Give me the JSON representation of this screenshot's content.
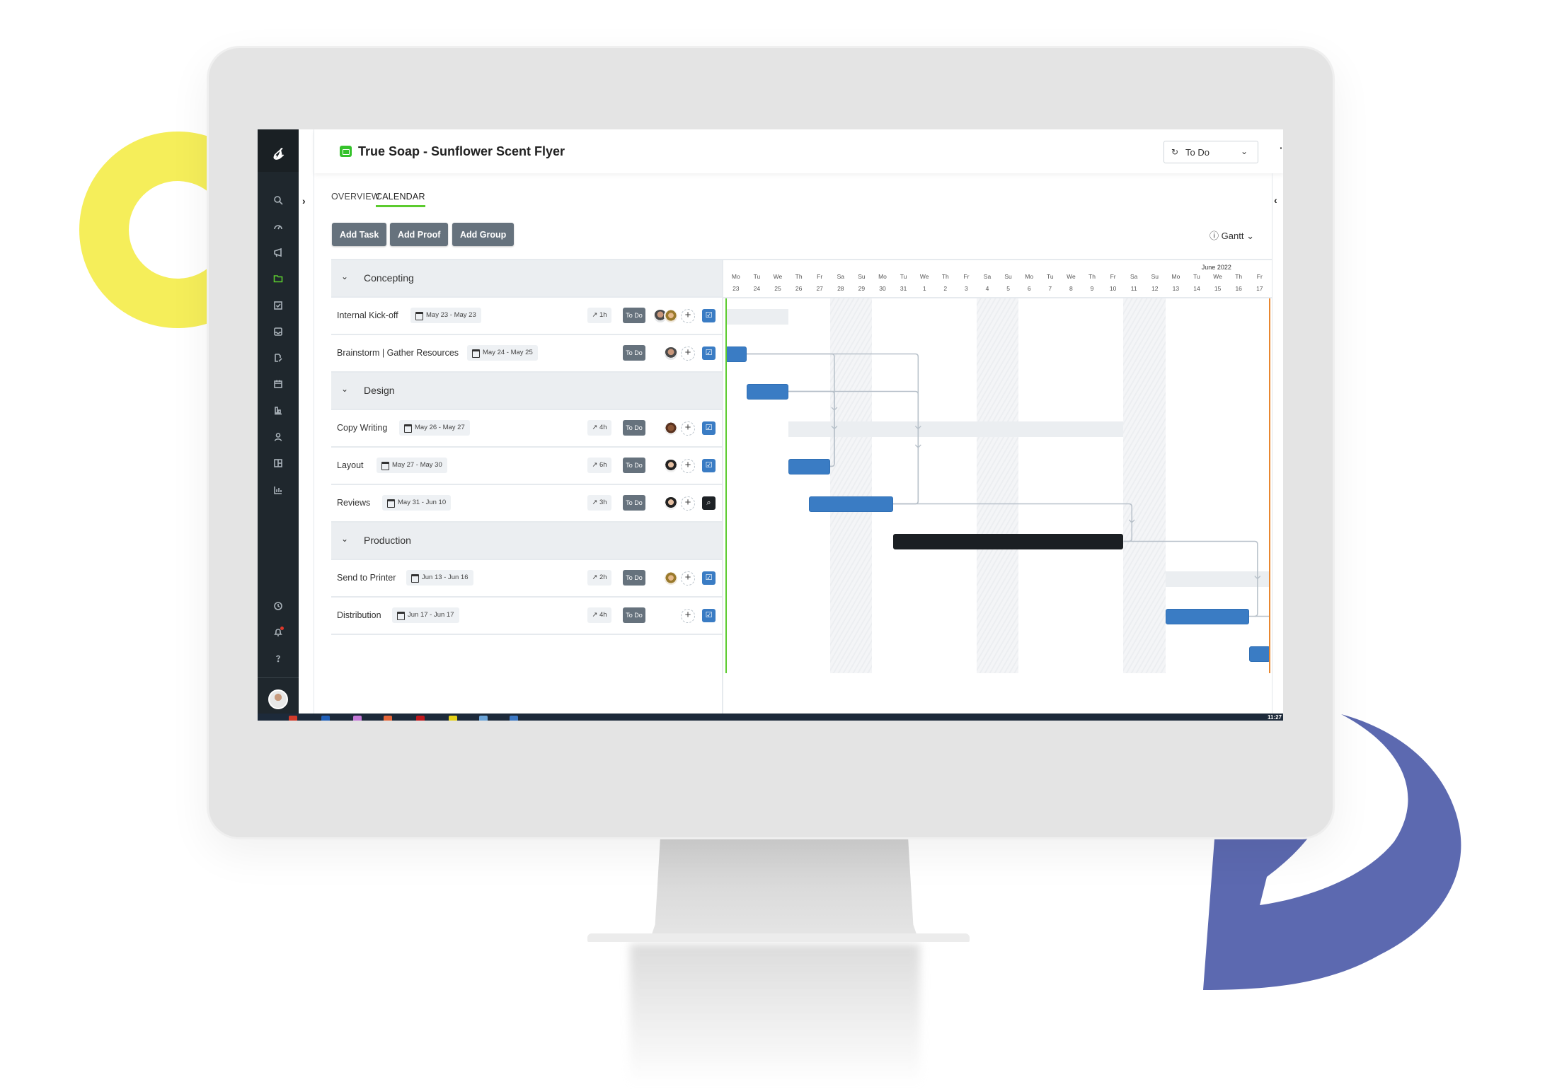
{
  "app": {
    "title": "True Soap - Sunflower Scent Flyer",
    "status_select": {
      "value": "To Do",
      "icon": "status-cycle-icon"
    },
    "more_menu_label": "···",
    "tabs": [
      {
        "label": "OVERVIEW",
        "active": false
      },
      {
        "label": "CALENDAR",
        "active": true
      }
    ],
    "toolbar": {
      "add_task": "Add Task",
      "add_proof": "Add Proof",
      "add_group": "Add Group"
    },
    "view_select": {
      "value": "Gantt",
      "icon": "info-icon"
    }
  },
  "sidebar": {
    "logo": "logo-icon",
    "items": [
      {
        "icon": "search-icon",
        "active": false
      },
      {
        "icon": "dashboard-gauge-icon",
        "active": false
      },
      {
        "icon": "megaphone-icon",
        "active": false
      },
      {
        "icon": "folder-icon",
        "active": true
      },
      {
        "icon": "task-check-icon",
        "active": false
      },
      {
        "icon": "inbox-icon",
        "active": false
      },
      {
        "icon": "proof-edit-icon",
        "active": false
      },
      {
        "icon": "calendar-icon",
        "active": false
      },
      {
        "icon": "resource-chart-icon",
        "active": false
      },
      {
        "icon": "user-icon",
        "active": false
      },
      {
        "icon": "layout-board-icon",
        "active": false
      },
      {
        "icon": "reports-icon",
        "active": false
      }
    ],
    "bottom_items": [
      {
        "icon": "clock-icon"
      },
      {
        "icon": "bell-icon",
        "has_notification": true
      },
      {
        "icon": "help-icon"
      }
    ]
  },
  "gantt": {
    "month_label": "June 2022",
    "days": [
      {
        "wd": "Mo",
        "d": "23"
      },
      {
        "wd": "Tu",
        "d": "24"
      },
      {
        "wd": "We",
        "d": "25"
      },
      {
        "wd": "Th",
        "d": "26"
      },
      {
        "wd": "Fr",
        "d": "27"
      },
      {
        "wd": "Sa",
        "d": "28"
      },
      {
        "wd": "Su",
        "d": "29"
      },
      {
        "wd": "Mo",
        "d": "30"
      },
      {
        "wd": "Tu",
        "d": "31"
      },
      {
        "wd": "We",
        "d": "1"
      },
      {
        "wd": "Th",
        "d": "2"
      },
      {
        "wd": "Fr",
        "d": "3"
      },
      {
        "wd": "Sa",
        "d": "4"
      },
      {
        "wd": "Su",
        "d": "5"
      },
      {
        "wd": "Mo",
        "d": "6"
      },
      {
        "wd": "Tu",
        "d": "7"
      },
      {
        "wd": "We",
        "d": "8"
      },
      {
        "wd": "Th",
        "d": "9"
      },
      {
        "wd": "Fr",
        "d": "10"
      },
      {
        "wd": "Sa",
        "d": "11"
      },
      {
        "wd": "Su",
        "d": "12"
      },
      {
        "wd": "Mo",
        "d": "13"
      },
      {
        "wd": "Tu",
        "d": "14"
      },
      {
        "wd": "We",
        "d": "15"
      },
      {
        "wd": "Th",
        "d": "16"
      },
      {
        "wd": "Fr",
        "d": "17"
      }
    ],
    "month_label_day_index": 23,
    "rows": [
      {
        "type": "group",
        "name": "Concepting",
        "start": 0,
        "end": 3
      },
      {
        "type": "task",
        "name": "Internal Kick-off",
        "dates": "May 23 - May 23",
        "hours": "1h",
        "status": "To Do",
        "assignees": [
          "av-m1",
          "av-f1"
        ],
        "task_type": "task",
        "start": 0,
        "end": 1,
        "bar": "blue"
      },
      {
        "type": "task",
        "name": "Brainstorm | Gather Resources",
        "dates": "May 24 - May 25",
        "hours": null,
        "status": "To Do",
        "assignees": [
          "av-m1"
        ],
        "task_type": "task",
        "start": 1,
        "end": 3,
        "bar": "blue"
      },
      {
        "type": "group",
        "name": "Design",
        "start": 3,
        "end": 19
      },
      {
        "type": "task",
        "name": "Copy Writing",
        "dates": "May 26 - May 27",
        "hours": "4h",
        "status": "To Do",
        "assignees": [
          "av-f2"
        ],
        "task_type": "task",
        "start": 3,
        "end": 5,
        "bar": "blue"
      },
      {
        "type": "task",
        "name": "Layout",
        "dates": "May 27 - May 30",
        "hours": "6h",
        "status": "To Do",
        "assignees": [
          "av-m2"
        ],
        "task_type": "task",
        "start": 4,
        "end": 8,
        "bar": "blue"
      },
      {
        "type": "task",
        "name": "Reviews",
        "dates": "May 31 - Jun 10",
        "hours": "3h",
        "status": "To Do",
        "assignees": [
          "av-m2"
        ],
        "task_type": "proof",
        "start": 8,
        "end": 19,
        "bar": "dark"
      },
      {
        "type": "group",
        "name": "Production",
        "start": 21,
        "end": 26
      },
      {
        "type": "task",
        "name": "Send to Printer",
        "dates": "Jun 13 - Jun 16",
        "hours": "2h",
        "status": "To Do",
        "assignees": [
          "av-f1"
        ],
        "task_type": "task",
        "start": 21,
        "end": 25,
        "bar": "blue"
      },
      {
        "type": "task",
        "name": "Distribution",
        "dates": "Jun 17 - Jun 17",
        "hours": "4h",
        "status": "To Do",
        "assignees": [],
        "task_type": "task",
        "start": 25,
        "end": 26,
        "bar": "blue"
      }
    ],
    "dependencies": [
      {
        "from": 1,
        "to": 4
      },
      {
        "from": 1,
        "to": 5
      },
      {
        "from": 2,
        "to": 4
      },
      {
        "from": 2,
        "to": 5
      },
      {
        "from": 5,
        "to": 6
      },
      {
        "from": 6,
        "to": 8
      }
    ],
    "colors": {
      "task_bar": "#3a7cc4",
      "proof_bar": "#1b1f23",
      "today_line": "#5ccb2f",
      "end_line": "#e9872f",
      "dependency": "#b7c0c9"
    }
  },
  "taskbar": {
    "clock": "11:27"
  }
}
